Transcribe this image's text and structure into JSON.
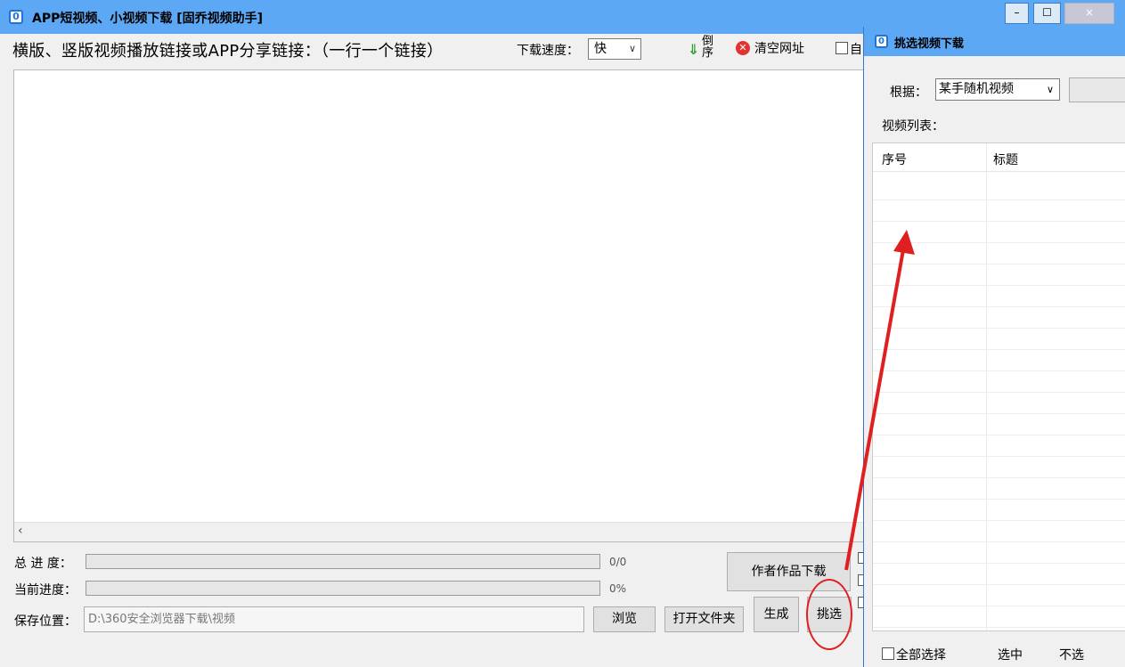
{
  "main_window": {
    "title": "APP短视频、小视频下载 [固乔视频助手]",
    "icon_glyph": "0",
    "window_controls": {
      "minimize": "–",
      "maximize": "☐",
      "close": "×"
    },
    "link_prompt": "横版、竖版视频播放链接或APP分享链接：（一行一个链接）",
    "speed_label": "下载速度：",
    "speed_value": "快",
    "reverse_label": "倒序",
    "clear_label": "清空网址",
    "auto_label": "自",
    "total_progress_label": "总 进 度：",
    "total_progress_value": "0/0",
    "total_progress_fraction": 0,
    "current_progress_label": "当前进度：",
    "current_progress_value": "0%",
    "current_progress_fraction": 0,
    "save_label": "保存位置：",
    "save_path": "D:\\360安全浏览器下载\\视频",
    "browse_label": "浏览",
    "open_folder_label": "打开文件夹",
    "author_download_label": "作者作品下载",
    "generate_label": "生成",
    "pick_label": "挑选",
    "colors": {
      "titlebar": "#5da8f4",
      "annotation": "#e02020",
      "progress_fill": "#06b025"
    }
  },
  "dialog": {
    "title": "挑选视频下载",
    "basis_label": "根据：",
    "basis_value": "某手随机视频",
    "video_list_label": "视频列表：",
    "columns": [
      "序号",
      "标题"
    ],
    "rows": [],
    "select_all_label": "全部选择",
    "select_label": "选中",
    "deselect_label": "不选"
  },
  "icons": [
    "app-icon",
    "down-arrow-icon",
    "clear-x-icon",
    "chevron-down-icon",
    "scroll-left-icon"
  ]
}
